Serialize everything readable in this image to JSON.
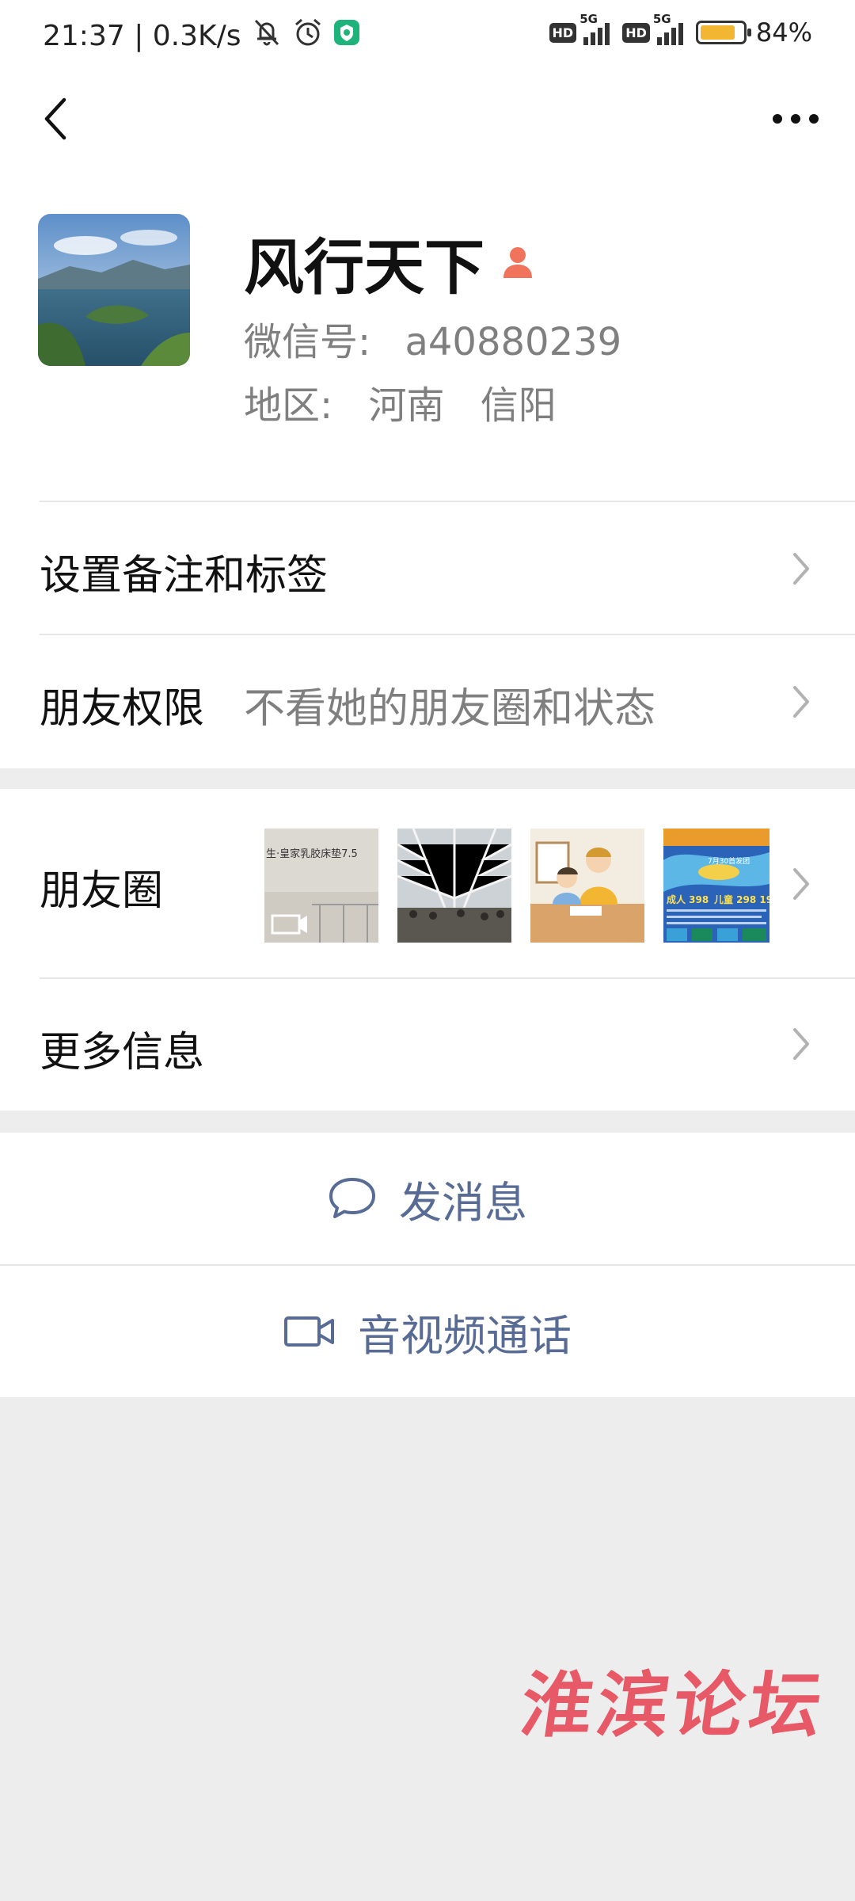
{
  "status_bar": {
    "time": "21:37",
    "network_speed": "0.3K/s",
    "hd_label": "HD",
    "network_type": "5G",
    "battery_percent": 84,
    "battery_label": "84%",
    "icons": [
      "mute-icon",
      "alarm-icon",
      "app-notification-icon"
    ]
  },
  "nav": {
    "back_icon": "chevron-left-icon",
    "more_icon": "more-dots-icon"
  },
  "profile": {
    "name": "风行天下",
    "gender_icon": "female-icon",
    "wechat_id_label": "微信号:",
    "wechat_id": "a40880239",
    "region_label": "地区:",
    "region_province": "河南",
    "region_city": "信阳"
  },
  "cells": {
    "remarks_tags": "设置备注和标签",
    "permissions_label": "朋友权限",
    "permissions_value": "不看她的朋友圈和状态",
    "moments_label": "朋友圈",
    "more_info": "更多信息"
  },
  "moments_thumbs": {
    "thumb1_text": "生·皇家乳胶床垫7.5",
    "thumb4_price1": "成人 398",
    "thumb4_price2": "儿童 298 19",
    "thumb4_date": "7月30首发团"
  },
  "actions": {
    "send_message": "发消息",
    "video_call": "音视频通话"
  },
  "watermark": "淮滨论坛",
  "colors": {
    "link": "#576b95",
    "secondary_text": "#7f7f7f",
    "background": "#ededed",
    "battery": "#f2b632",
    "female_icon": "#f0735b",
    "watermark": "#e84a5a"
  }
}
